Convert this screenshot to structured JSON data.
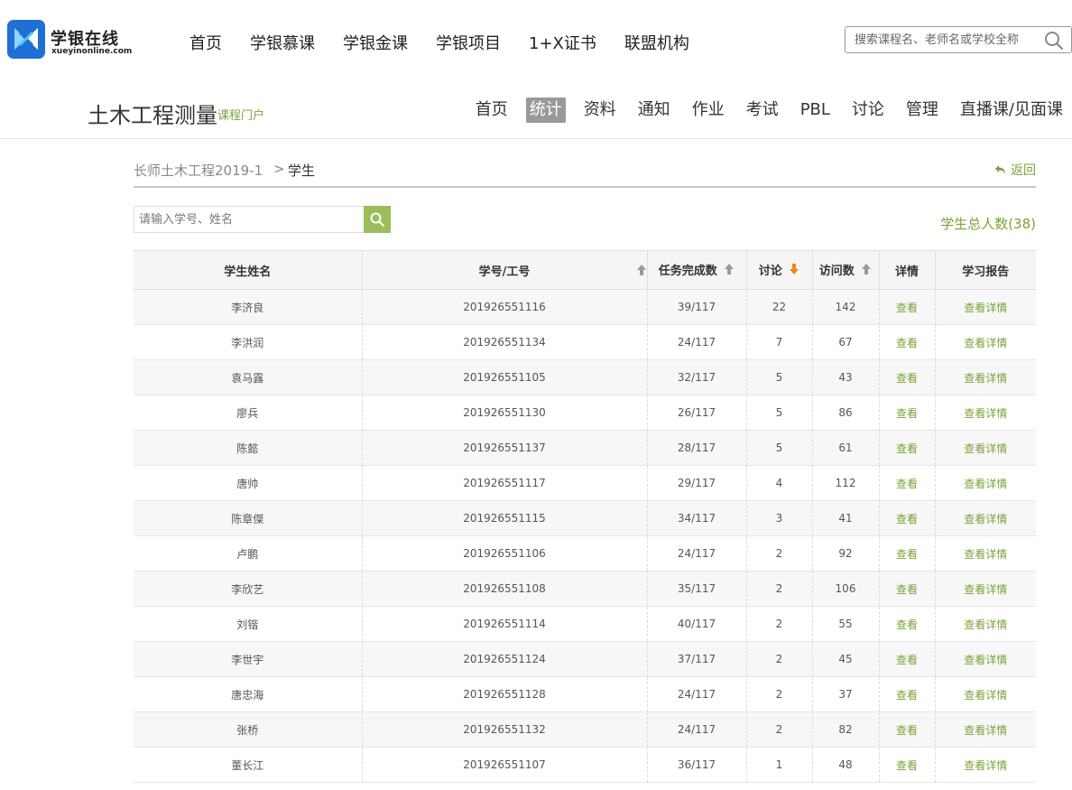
{
  "brand": {
    "name": "学银在线",
    "domain": "xueyinonline.com"
  },
  "main_nav": [
    "首页",
    "学银慕课",
    "学银金课",
    "学银项目",
    "1+X证书",
    "联盟机构"
  ],
  "site_search": {
    "placeholder": "搜索课程名、老师名或学校全称"
  },
  "course": {
    "title": "土木工程测量",
    "portal": "课程门户",
    "nav": [
      "首页",
      "统计",
      "资料",
      "通知",
      "作业",
      "考试",
      "PBL",
      "讨论",
      "管理",
      "直播课/见面课"
    ],
    "active_nav": "统计"
  },
  "breadcrumb": {
    "class_name": "长师土木工程2019-1",
    "separator": ">",
    "current": "学生",
    "back": "返回"
  },
  "student_search": {
    "placeholder": "请输入学号、姓名"
  },
  "total_label": "学生总人数(38)",
  "colors": {
    "accent": "#7aa33a",
    "button": "#9bbd5a",
    "sort_active": "#f08519",
    "sort_idle": "#999999"
  },
  "table": {
    "headers": {
      "name": "学生姓名",
      "id": "学号/工号",
      "tasks": "任务完成数",
      "discuss": "讨论",
      "visits": "访问数",
      "detail": "详情",
      "report": "学习报告"
    },
    "view_label": "查看",
    "report_label": "查看详情",
    "rows": [
      {
        "name": "李济良",
        "id": "201926551116",
        "tasks": "39/117",
        "discuss": "22",
        "visits": "142"
      },
      {
        "name": "李洪润",
        "id": "201926551134",
        "tasks": "24/117",
        "discuss": "7",
        "visits": "67"
      },
      {
        "name": "袁马露",
        "id": "201926551105",
        "tasks": "32/117",
        "discuss": "5",
        "visits": "43"
      },
      {
        "name": "廖兵",
        "id": "201926551130",
        "tasks": "26/117",
        "discuss": "5",
        "visits": "86"
      },
      {
        "name": "陈懿",
        "id": "201926551137",
        "tasks": "28/117",
        "discuss": "5",
        "visits": "61"
      },
      {
        "name": "唐帅",
        "id": "201926551117",
        "tasks": "29/117",
        "discuss": "4",
        "visits": "112"
      },
      {
        "name": "陈章傑",
        "id": "201926551115",
        "tasks": "34/117",
        "discuss": "3",
        "visits": "41"
      },
      {
        "name": "卢鹏",
        "id": "201926551106",
        "tasks": "24/117",
        "discuss": "2",
        "visits": "92"
      },
      {
        "name": "李欣艺",
        "id": "201926551108",
        "tasks": "35/117",
        "discuss": "2",
        "visits": "106"
      },
      {
        "name": "刘锴",
        "id": "201926551114",
        "tasks": "40/117",
        "discuss": "2",
        "visits": "55"
      },
      {
        "name": "李世宇",
        "id": "201926551124",
        "tasks": "37/117",
        "discuss": "2",
        "visits": "45"
      },
      {
        "name": "唐忠海",
        "id": "201926551128",
        "tasks": "24/117",
        "discuss": "2",
        "visits": "37"
      },
      {
        "name": "张桥",
        "id": "201926551132",
        "tasks": "24/117",
        "discuss": "2",
        "visits": "82"
      },
      {
        "name": "董长江",
        "id": "201926551107",
        "tasks": "36/117",
        "discuss": "1",
        "visits": "48"
      }
    ]
  }
}
